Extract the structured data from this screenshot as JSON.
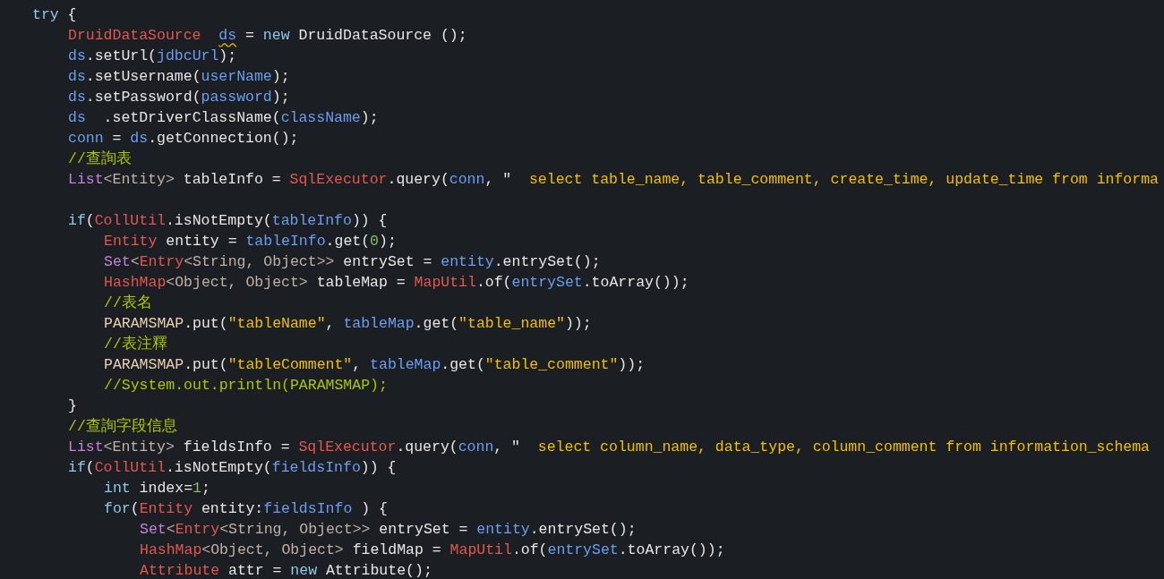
{
  "code_lines": [
    {
      "kind": "code",
      "tokens": [
        {
          "kind": "keyword",
          "text": "try"
        },
        {
          "kind": "plain",
          "text": " {"
        }
      ],
      "children": [
        {
          "kind": "code",
          "tokens": [
            {
              "kind": "type",
              "text": "DruidDataSource  "
            },
            {
              "kind": "warnvar",
              "text": "ds"
            },
            {
              "kind": "plain",
              "text": " = "
            },
            {
              "kind": "keyword",
              "text": "new"
            },
            {
              "kind": "plain",
              "text": " DruidDataSource ();"
            }
          ]
        },
        {
          "kind": "code",
          "tokens": [
            {
              "kind": "var",
              "text": "ds"
            },
            {
              "kind": "plain",
              "text": ".setUrl("
            },
            {
              "kind": "var",
              "text": "jdbcUrl"
            },
            {
              "kind": "plain",
              "text": ");"
            }
          ]
        },
        {
          "kind": "code",
          "tokens": [
            {
              "kind": "var",
              "text": "ds"
            },
            {
              "kind": "plain",
              "text": ".setUsername("
            },
            {
              "kind": "var",
              "text": "userName"
            },
            {
              "kind": "plain",
              "text": ");"
            }
          ]
        },
        {
          "kind": "code",
          "tokens": [
            {
              "kind": "var",
              "text": "ds"
            },
            {
              "kind": "plain",
              "text": ".setPassword("
            },
            {
              "kind": "var",
              "text": "password"
            },
            {
              "kind": "plain",
              "text": ");"
            }
          ]
        },
        {
          "kind": "code",
          "tokens": [
            {
              "kind": "var",
              "text": "ds"
            },
            {
              "kind": "plain",
              "text": "  .setDriverClassName("
            },
            {
              "kind": "var",
              "text": "className"
            },
            {
              "kind": "plain",
              "text": ");"
            }
          ]
        },
        {
          "kind": "code",
          "tokens": [
            {
              "kind": "var",
              "text": "conn"
            },
            {
              "kind": "plain",
              "text": " = "
            },
            {
              "kind": "var",
              "text": "ds"
            },
            {
              "kind": "plain",
              "text": ".getConnection();"
            }
          ]
        },
        {
          "kind": "code",
          "tokens": [
            {
              "kind": "comment",
              "text": "//查詢表"
            }
          ]
        },
        {
          "kind": "code",
          "tokens": [
            {
              "kind": "generic",
              "text": "List"
            },
            {
              "kind": "typeparam",
              "text": "<Entity>"
            },
            {
              "kind": "plain",
              "text": " tableInfo = "
            },
            {
              "kind": "type",
              "text": "SqlExecutor"
            },
            {
              "kind": "plain",
              "text": ".query("
            },
            {
              "kind": "var",
              "text": "conn"
            },
            {
              "kind": "plain",
              "text": ", \"  "
            },
            {
              "kind": "string",
              "text": "select table_name, table_comment, create_time, update_time from informa"
            }
          ]
        },
        {
          "kind": "blank"
        },
        {
          "kind": "code",
          "tokens": [
            {
              "kind": "keyword",
              "text": "if"
            },
            {
              "kind": "plain",
              "text": "("
            },
            {
              "kind": "type",
              "text": "CollUtil"
            },
            {
              "kind": "plain",
              "text": ".isNotEmpty("
            },
            {
              "kind": "var",
              "text": "tableInfo"
            },
            {
              "kind": "plain",
              "text": ")) {"
            }
          ],
          "children": [
            {
              "kind": "code",
              "tokens": [
                {
                  "kind": "type",
                  "text": "Entity"
                },
                {
                  "kind": "plain",
                  "text": " entity = "
                },
                {
                  "kind": "var",
                  "text": "tableInfo"
                },
                {
                  "kind": "plain",
                  "text": ".get("
                },
                {
                  "kind": "number",
                  "text": "0"
                },
                {
                  "kind": "plain",
                  "text": ");"
                }
              ]
            },
            {
              "kind": "code",
              "tokens": [
                {
                  "kind": "generic",
                  "text": "Set"
                },
                {
                  "kind": "typeparam",
                  "text": "<"
                },
                {
                  "kind": "type",
                  "text": "Entry"
                },
                {
                  "kind": "typeparam",
                  "text": "<String, Object>>"
                },
                {
                  "kind": "plain",
                  "text": " entrySet = "
                },
                {
                  "kind": "var",
                  "text": "entity"
                },
                {
                  "kind": "plain",
                  "text": ".entrySet();"
                }
              ]
            },
            {
              "kind": "code",
              "tokens": [
                {
                  "kind": "type",
                  "text": "HashMap"
                },
                {
                  "kind": "typeparam",
                  "text": "<Object, Object>"
                },
                {
                  "kind": "plain",
                  "text": " tableMap = "
                },
                {
                  "kind": "type",
                  "text": "MapUtil"
                },
                {
                  "kind": "plain",
                  "text": ".of("
                },
                {
                  "kind": "var",
                  "text": "entrySet"
                },
                {
                  "kind": "plain",
                  "text": ".toArray());"
                }
              ]
            },
            {
              "kind": "code",
              "tokens": [
                {
                  "kind": "comment",
                  "text": "//表名"
                }
              ]
            },
            {
              "kind": "code",
              "tokens": [
                {
                  "kind": "constant",
                  "text": "PARAMSMAP"
                },
                {
                  "kind": "plain",
                  "text": ".put("
                },
                {
                  "kind": "string",
                  "text": "\"tableName\""
                },
                {
                  "kind": "plain",
                  "text": ", "
                },
                {
                  "kind": "var",
                  "text": "tableMap"
                },
                {
                  "kind": "plain",
                  "text": ".get("
                },
                {
                  "kind": "string",
                  "text": "\"table_name\""
                },
                {
                  "kind": "plain",
                  "text": "));"
                }
              ]
            },
            {
              "kind": "code",
              "tokens": [
                {
                  "kind": "comment",
                  "text": "//表注釋"
                }
              ]
            },
            {
              "kind": "code",
              "tokens": [
                {
                  "kind": "constant",
                  "text": "PARAMSMAP"
                },
                {
                  "kind": "plain",
                  "text": ".put("
                },
                {
                  "kind": "string",
                  "text": "\"tableComment\""
                },
                {
                  "kind": "plain",
                  "text": ", "
                },
                {
                  "kind": "var",
                  "text": "tableMap"
                },
                {
                  "kind": "plain",
                  "text": ".get("
                },
                {
                  "kind": "string",
                  "text": "\"table_comment\""
                },
                {
                  "kind": "plain",
                  "text": "));"
                }
              ]
            },
            {
              "kind": "code",
              "tokens": [
                {
                  "kind": "comment",
                  "text": "//System.out.println(PARAMSMAP);"
                }
              ]
            }
          ]
        },
        {
          "kind": "code",
          "tokens": [
            {
              "kind": "plain",
              "text": "}"
            }
          ]
        },
        {
          "kind": "code",
          "tokens": [
            {
              "kind": "comment",
              "text": "//查詢字段信息"
            }
          ]
        },
        {
          "kind": "code",
          "tokens": [
            {
              "kind": "generic",
              "text": "List"
            },
            {
              "kind": "typeparam",
              "text": "<Entity>"
            },
            {
              "kind": "plain",
              "text": " fieldsInfo = "
            },
            {
              "kind": "type",
              "text": "SqlExecutor"
            },
            {
              "kind": "plain",
              "text": ".query("
            },
            {
              "kind": "var",
              "text": "conn"
            },
            {
              "kind": "plain",
              "text": ", \"  "
            },
            {
              "kind": "string",
              "text": "select column_name, data_type, column_comment from information_schema"
            }
          ]
        },
        {
          "kind": "code",
          "tokens": [
            {
              "kind": "keyword",
              "text": "if"
            },
            {
              "kind": "plain",
              "text": "("
            },
            {
              "kind": "type",
              "text": "CollUtil"
            },
            {
              "kind": "plain",
              "text": ".isNotEmpty("
            },
            {
              "kind": "var",
              "text": "fieldsInfo"
            },
            {
              "kind": "plain",
              "text": ")) {"
            }
          ],
          "children": [
            {
              "kind": "code",
              "tokens": [
                {
                  "kind": "keyword",
                  "text": "int"
                },
                {
                  "kind": "plain",
                  "text": " index="
                },
                {
                  "kind": "number",
                  "text": "1"
                },
                {
                  "kind": "plain",
                  "text": ";"
                }
              ]
            },
            {
              "kind": "code",
              "tokens": [
                {
                  "kind": "keyword",
                  "text": "for"
                },
                {
                  "kind": "plain",
                  "text": "("
                },
                {
                  "kind": "type",
                  "text": "Entity"
                },
                {
                  "kind": "plain",
                  "text": " entity:"
                },
                {
                  "kind": "var",
                  "text": "fieldsInfo"
                },
                {
                  "kind": "plain",
                  "text": " ) {"
                }
              ],
              "children": [
                {
                  "kind": "code",
                  "tokens": [
                    {
                      "kind": "generic",
                      "text": "Set"
                    },
                    {
                      "kind": "typeparam",
                      "text": "<"
                    },
                    {
                      "kind": "type",
                      "text": "Entry"
                    },
                    {
                      "kind": "typeparam",
                      "text": "<String, Object>>"
                    },
                    {
                      "kind": "plain",
                      "text": " entrySet = "
                    },
                    {
                      "kind": "var",
                      "text": "entity"
                    },
                    {
                      "kind": "plain",
                      "text": ".entrySet();"
                    }
                  ]
                },
                {
                  "kind": "code",
                  "tokens": [
                    {
                      "kind": "type",
                      "text": "HashMap"
                    },
                    {
                      "kind": "typeparam",
                      "text": "<Object, Object>"
                    },
                    {
                      "kind": "plain",
                      "text": " fieldMap = "
                    },
                    {
                      "kind": "type",
                      "text": "MapUtil"
                    },
                    {
                      "kind": "plain",
                      "text": ".of("
                    },
                    {
                      "kind": "var",
                      "text": "entrySet"
                    },
                    {
                      "kind": "plain",
                      "text": ".toArray());"
                    }
                  ]
                },
                {
                  "kind": "code",
                  "tokens": [
                    {
                      "kind": "type",
                      "text": "Attribute"
                    },
                    {
                      "kind": "plain",
                      "text": " attr = "
                    },
                    {
                      "kind": "keyword",
                      "text": "new"
                    },
                    {
                      "kind": "plain",
                      "text": " Attribute();"
                    }
                  ]
                }
              ]
            }
          ]
        }
      ]
    }
  ]
}
